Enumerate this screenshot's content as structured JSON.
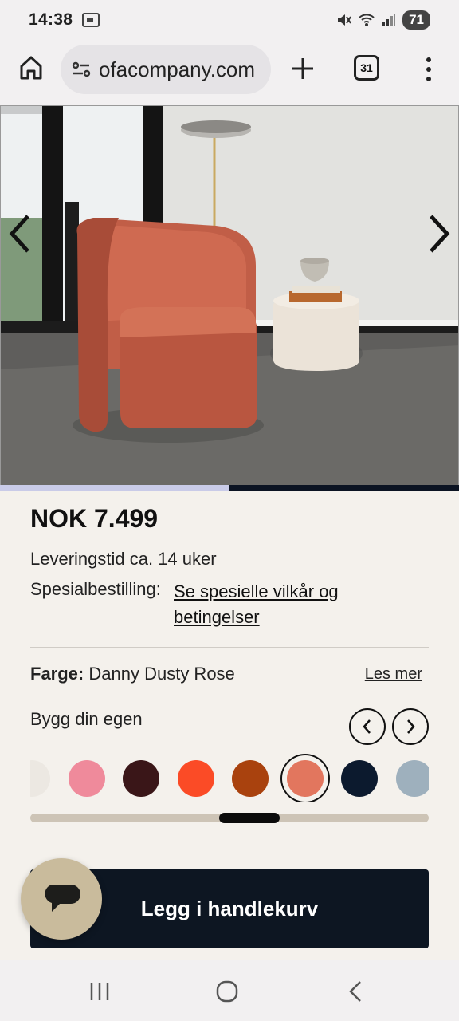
{
  "status_bar": {
    "time": "14:38",
    "battery": "71",
    "icons": [
      "screenshot-icon",
      "mute-icon",
      "wifi-icon",
      "signal-icon",
      "battery-icon"
    ]
  },
  "browser": {
    "url": "ofacompany.com",
    "tab_count": "31",
    "icons": [
      "home-icon",
      "site-settings-icon",
      "new-tab-icon",
      "tabs-icon",
      "more-vert-icon"
    ]
  },
  "gallery": {
    "image_alt": "Orange velvet swivel armchair with a round boucle side table and pendant lamp",
    "progress_fraction": 0.5,
    "icons": [
      "chevron-left-icon",
      "chevron-right-icon"
    ]
  },
  "product": {
    "price": "NOK 7.499",
    "delivery": "Leveringstid ca. 14 uker",
    "special_label": "Spesialbestilling:",
    "special_link": "Se spesielle vilkår og betingelser",
    "color_label": "Farge:",
    "color_value": "Danny Dusty Rose",
    "read_more": "Les mer",
    "build_label": "Bygg din egen"
  },
  "swatches": [
    {
      "color": "#ece8e2",
      "selected": false
    },
    {
      "color": "#ef8a9b",
      "selected": false
    },
    {
      "color": "#3a1618",
      "selected": false
    },
    {
      "color": "#fb4b26",
      "selected": false
    },
    {
      "color": "#a9420e",
      "selected": false
    },
    {
      "color": "#e2765e",
      "selected": true
    },
    {
      "color": "#0c1a2e",
      "selected": false
    },
    {
      "color": "#9eb0bd",
      "selected": false
    }
  ],
  "swatch_scroll_fraction": 0.56,
  "cart": {
    "label": "Legg i handlekurv"
  },
  "chat": {
    "icon": "chat-icon"
  },
  "android_nav": {
    "icons": [
      "recents-icon",
      "home-circle-icon",
      "back-icon"
    ]
  },
  "colors": {
    "primary_dark": "#0d1622",
    "background": "#f4f1ec",
    "chat_bubble": "#c9bb9c"
  }
}
